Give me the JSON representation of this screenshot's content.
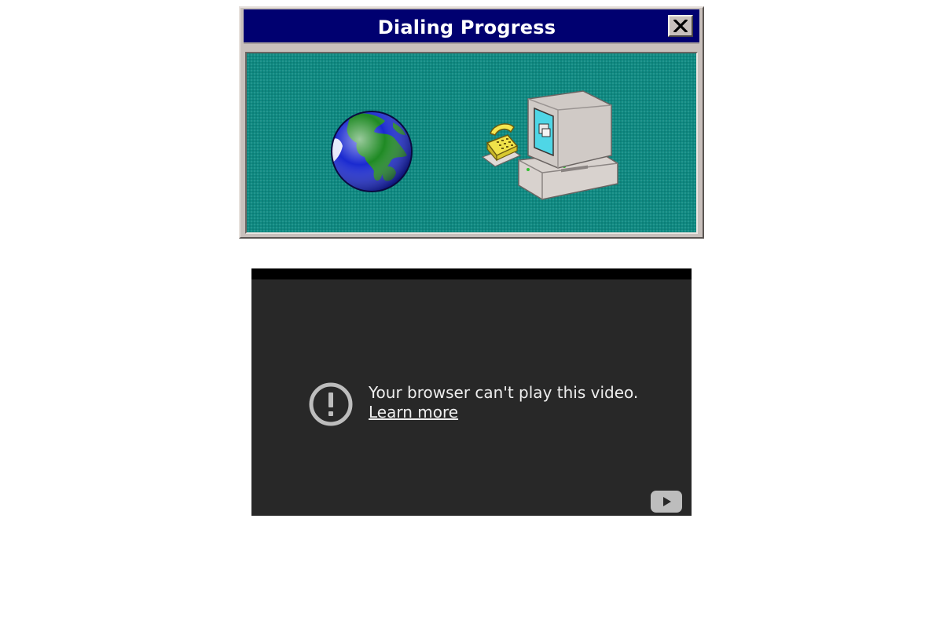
{
  "dialog": {
    "title": "Dialing Progress",
    "close_icon": "close-x-icon",
    "colors": {
      "titlebar": "#000070",
      "panel": "#0f8a82",
      "chrome": "#c8c0bc"
    },
    "illustration": {
      "left_icon": "globe-icon",
      "right_icon": "computer-with-phone-icon"
    }
  },
  "player": {
    "error_icon": "exclamation-circle-icon",
    "error_message": "Your browser can't play this video.",
    "learn_more_label": "Learn more",
    "logo_icon": "youtube-logo-icon",
    "colors": {
      "background": "#282828",
      "text": "#eeeeee"
    }
  }
}
